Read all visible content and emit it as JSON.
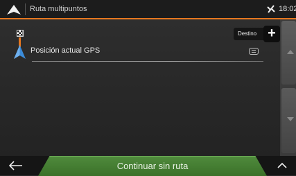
{
  "header": {
    "title": "Ruta multipuntos",
    "time": "18:02"
  },
  "route": {
    "destination_label": "Destino",
    "add_symbol": "+",
    "start_point": "Posición actual GPS"
  },
  "footer": {
    "continue_label": "Continuar sin ruta"
  },
  "icons": {
    "logo": "nav-arrow-logo-icon",
    "gps": "gps-satellite-icon",
    "checkered": "checkered-flag-icon",
    "position": "navigation-arrow-icon",
    "details": "message-icon",
    "back": "back-arrow-icon",
    "menu": "chevron-up-icon"
  },
  "colors": {
    "accent": "#e6771f",
    "position_arrow": "#3b8bd8",
    "continue_button": "#4f8a3c"
  }
}
